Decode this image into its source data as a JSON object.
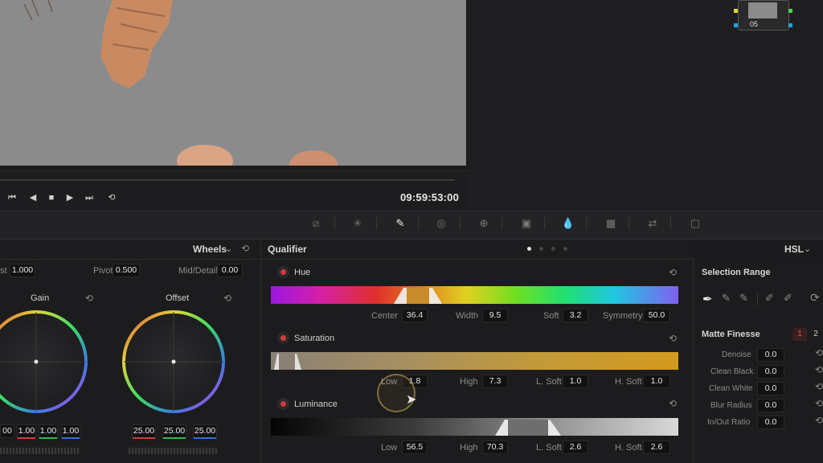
{
  "viewer": {
    "timecode": "09:59:53:00",
    "node_label": "05"
  },
  "toolbar": {
    "icons": [
      "curves-icon",
      "color-warper-icon",
      "qualifier-icon",
      "window-icon",
      "tracker-icon",
      "magic-mask-icon",
      "blur-icon",
      "key-icon",
      "sizing-icon",
      "3d-icon"
    ]
  },
  "wheels": {
    "mode_label": "Wheels",
    "contrast_label": "st",
    "contrast_value": "1.000",
    "pivot_label": "Pivot",
    "pivot_value": "0.500",
    "middetail_label": "Mid/Detail",
    "middetail_value": "0.00",
    "gain": {
      "label": "Gain",
      "values": [
        "00",
        "1.00",
        "1.00",
        "1.00"
      ]
    },
    "offset": {
      "label": "Offset",
      "values": [
        "25.00",
        "25.00",
        "25.00"
      ]
    }
  },
  "qualifier": {
    "title": "Qualifier",
    "mode": "HSL",
    "hue": {
      "label": "Hue",
      "center_label": "Center",
      "center": "36.4",
      "width_label": "Width",
      "width": "9.5",
      "soft_label": "Soft",
      "soft": "3.2",
      "symmetry_label": "Symmetry",
      "symmetry": "50.0"
    },
    "saturation": {
      "label": "Saturation",
      "low_label": "Low",
      "low": "1.8",
      "high_label": "High",
      "high": "7.3",
      "lsoft_label": "L. Soft",
      "lsoft": "1.0",
      "hsoft_label": "H. Soft",
      "hsoft": "1.0"
    },
    "luminance": {
      "label": "Luminance",
      "low_label": "Low",
      "low": "56.5",
      "high_label": "High",
      "high": "70.3",
      "lsoft_label": "L. Soft",
      "lsoft": "2.6",
      "hsoft_label": "H. Soft",
      "hsoft": "2.6"
    }
  },
  "selection": {
    "title": "Selection Range",
    "matte_title": "Matte Finesse",
    "tab1": "1",
    "tab2": "2",
    "rows": [
      {
        "label": "Denoise",
        "value": "0.0"
      },
      {
        "label": "Clean Black",
        "value": "0.0"
      },
      {
        "label": "Clean White",
        "value": "0.0"
      },
      {
        "label": "Blur Radius",
        "value": "0.0"
      },
      {
        "label": "In/Out Ratio",
        "value": "0.0"
      }
    ]
  },
  "colors": {
    "accent": "#d43a3a",
    "viewer_bg": "#8b8b8b",
    "sat_gold": "#d39a1f"
  }
}
